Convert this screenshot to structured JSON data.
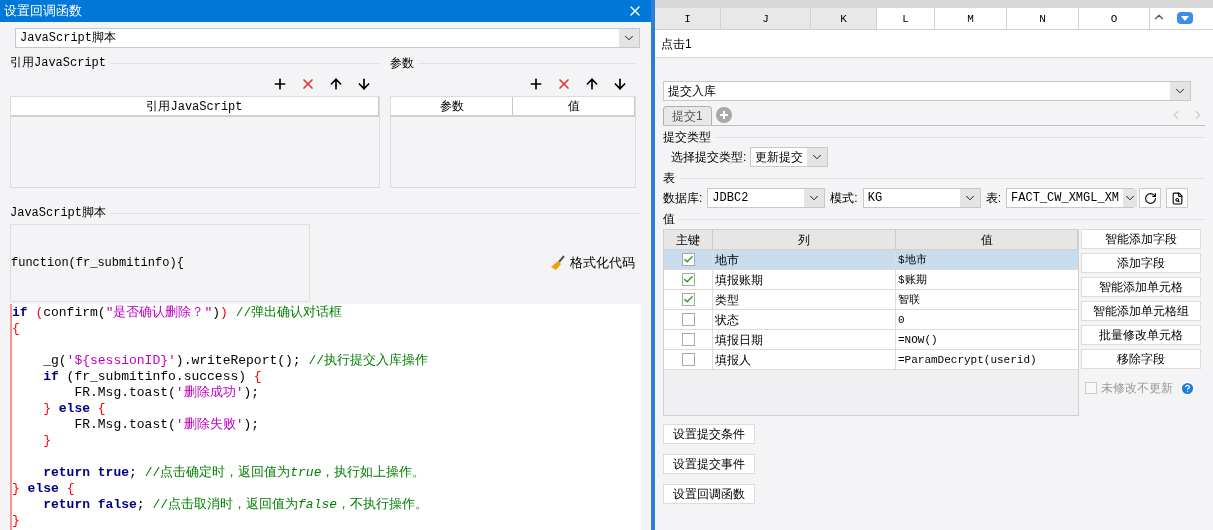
{
  "dialog": {
    "title": "设置回调函数",
    "type_select": {
      "value": "JavaScript脚本"
    },
    "ref_section": {
      "title": "引用JavaScript",
      "columns": [
        "引用JavaScript"
      ]
    },
    "param_section": {
      "title": "参数",
      "columns": [
        "参数",
        "值"
      ]
    },
    "script_section": {
      "title": "JavaScript脚本",
      "signature": "function(fr_submitinfo){",
      "format_button": "格式化代码"
    },
    "code_lines": [
      {
        "kind": "code",
        "tokens": [
          {
            "kind": "kw",
            "t": "if "
          },
          {
            "kind": "brace",
            "t": "("
          },
          {
            "kind": "plain",
            "t": "confirm("
          },
          {
            "kind": "str",
            "t": "\"是否确认删除？\""
          },
          {
            "kind": "plain",
            "t": ")"
          },
          {
            "kind": "brace",
            "t": ") "
          },
          {
            "kind": "cmt",
            "t": "//弹出确认对话框"
          }
        ]
      },
      {
        "kind": "code",
        "tokens": [
          {
            "kind": "brace",
            "t": "{"
          }
        ]
      },
      {
        "kind": "blank"
      },
      {
        "kind": "code",
        "tokens": [
          {
            "kind": "plain",
            "t": "    _g("
          },
          {
            "kind": "str",
            "t": "'${sessionID}'"
          },
          {
            "kind": "plain",
            "t": ").writeReport(); "
          },
          {
            "kind": "cmt",
            "t": "//执行提交入库操作"
          }
        ]
      },
      {
        "kind": "code",
        "tokens": [
          {
            "kind": "kw",
            "t": "    if"
          },
          {
            "kind": "plain",
            "t": " (fr_submitinfo.success) "
          },
          {
            "kind": "brace",
            "t": "{"
          }
        ]
      },
      {
        "kind": "code",
        "tokens": [
          {
            "kind": "plain",
            "t": "        FR.Msg.toast("
          },
          {
            "kind": "str",
            "t": "'删除成功'"
          },
          {
            "kind": "plain",
            "t": ");"
          }
        ]
      },
      {
        "kind": "code",
        "tokens": [
          {
            "kind": "brace",
            "t": "    } "
          },
          {
            "kind": "kw",
            "t": "else "
          },
          {
            "kind": "brace",
            "t": "{"
          }
        ]
      },
      {
        "kind": "code",
        "tokens": [
          {
            "kind": "plain",
            "t": "        FR.Msg.toast("
          },
          {
            "kind": "str",
            "t": "'删除失败'"
          },
          {
            "kind": "plain",
            "t": ");"
          }
        ]
      },
      {
        "kind": "code",
        "tokens": [
          {
            "kind": "brace",
            "t": "    }"
          }
        ]
      },
      {
        "kind": "blank"
      },
      {
        "kind": "code",
        "tokens": [
          {
            "kind": "kw",
            "t": "    return true"
          },
          {
            "kind": "plain",
            "t": "; "
          },
          {
            "kind": "cmt",
            "t": "//点击确定时，返回值为"
          },
          {
            "kind": "cmt_em",
            "t": "true"
          },
          {
            "kind": "cmt",
            "t": "，执行如上操作。"
          }
        ]
      },
      {
        "kind": "code",
        "tokens": [
          {
            "kind": "brace",
            "t": "} "
          },
          {
            "kind": "kw",
            "t": "else "
          },
          {
            "kind": "brace",
            "t": "{"
          }
        ]
      },
      {
        "kind": "code",
        "tokens": [
          {
            "kind": "kw",
            "t": "    return false"
          },
          {
            "kind": "plain",
            "t": "; "
          },
          {
            "kind": "cmt",
            "t": "//点击取消时，返回值为"
          },
          {
            "kind": "cmt_em",
            "t": "false"
          },
          {
            "kind": "cmt",
            "t": "，不执行操作。"
          }
        ]
      },
      {
        "kind": "code",
        "tokens": [
          {
            "kind": "brace",
            "t": "}"
          }
        ]
      }
    ]
  },
  "sheet": {
    "columns": [
      {
        "label": "I",
        "selected": true
      },
      {
        "label": "J",
        "selected": true
      },
      {
        "label": "K",
        "selected": true
      },
      {
        "label": "L",
        "selected": false
      },
      {
        "label": "M",
        "selected": false
      },
      {
        "label": "N",
        "selected": false
      },
      {
        "label": "O",
        "selected": false
      }
    ]
  },
  "cell_label": "点击1",
  "submit": {
    "mode_select": "提交入库",
    "tabs": [
      {
        "label": "提交1",
        "selected": true
      }
    ],
    "type_heading": "提交类型",
    "type_label": "选择提交类型:",
    "type_value": "更新提交",
    "table_heading": "表",
    "db_label": "数据库:",
    "db_value": "JDBC2",
    "schema_label": "模式:",
    "schema_value": "KG",
    "table_label": "表:",
    "table_value": "FACT_CW_XMGL_XM",
    "value_heading": "值",
    "grid": {
      "columns": [
        "主键",
        "列",
        "值"
      ],
      "rows": [
        {
          "key": true,
          "column": "地市",
          "value": "$地市",
          "selected": true
        },
        {
          "key": true,
          "column": "填报账期",
          "value": "$账期",
          "selected": false
        },
        {
          "key": true,
          "column": "类型",
          "value": "智联",
          "selected": false
        },
        {
          "key": false,
          "column": "状态",
          "value": "0",
          "selected": false
        },
        {
          "key": false,
          "column": "填报日期",
          "value": "=NOW()",
          "selected": false
        },
        {
          "key": false,
          "column": "填报人",
          "value": "=ParamDecrypt(userid)",
          "selected": false
        }
      ]
    },
    "side_buttons": [
      "智能添加字段",
      "添加字段",
      "智能添加单元格",
      "智能添加单元格组",
      "批量修改单元格",
      "移除字段"
    ],
    "no_update": {
      "label": "未修改不更新",
      "checked": false,
      "disabled": true
    },
    "bottom_buttons": [
      "设置提交条件",
      "设置提交事件",
      "设置回调函数"
    ]
  }
}
